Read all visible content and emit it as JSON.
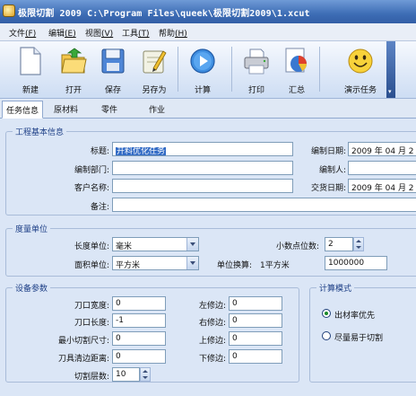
{
  "window": {
    "title": "极限切割  2009 C:\\Program Files\\queek\\极限切割2009\\1.xcut"
  },
  "menu": [
    {
      "label": "文件",
      "key": "(F)"
    },
    {
      "label": "编辑",
      "key": "(E)"
    },
    {
      "label": "视图",
      "key": "(V)"
    },
    {
      "label": "工具",
      "key": "(T)"
    },
    {
      "label": "帮助",
      "key": "(H)"
    }
  ],
  "toolbar": {
    "new": "新建",
    "open": "打开",
    "save": "保存",
    "save_as": "另存为",
    "calc": "计算",
    "print": "打印",
    "summary": "汇总",
    "demo": "演示任务"
  },
  "tabs": [
    "任务信息",
    "原材料",
    "零件",
    "作业"
  ],
  "project_info": {
    "group_title": "工程基本信息",
    "title_label": "标题:",
    "title_value": "开料优化任务",
    "compile_date_label": "编制日期:",
    "compile_date_value": "2009 年 04 月 2",
    "dept_label": "编制部门:",
    "dept_value": "",
    "author_label": "编制人:",
    "author_value": "",
    "client_label": "客户名称:",
    "client_value": "",
    "delivery_label": "交货日期:",
    "delivery_value": "2009 年 04 月 2",
    "note_label": "备注:",
    "note_value": ""
  },
  "units": {
    "group_title": "度量单位",
    "length_label": "长度单位:",
    "length_value": "毫米",
    "decimals_label": "小数点位数:",
    "decimals_value": "2",
    "area_label": "面积单位:",
    "area_value": "平方米",
    "conversion_label": "单位换算:",
    "conversion_unit": "1平方米",
    "conversion_value": "1000000"
  },
  "equipment": {
    "group_title": "设备参数",
    "blade_width_label": "刀口宽度:",
    "blade_width_value": "0",
    "blade_length_label": "刀口长度:",
    "blade_length_value": "-1",
    "min_cut_label": "最小切割尺寸:",
    "min_cut_value": "0",
    "tool_clear_label": "刀具清边距离:",
    "tool_clear_value": "0",
    "layers_label": "切割层数:",
    "layers_value": "10",
    "left_trim_label": "左修边:",
    "left_trim_value": "0",
    "right_trim_label": "右修边:",
    "right_trim_value": "0",
    "top_trim_label": "上修边:",
    "top_trim_value": "0",
    "bottom_trim_label": "下修边:",
    "bottom_trim_value": "0"
  },
  "calc_mode": {
    "group_title": "计算模式",
    "option1": "出材率优先",
    "option2": "尽量易于切割",
    "selected": "出材率优先"
  },
  "colors": {
    "titlebar": "#3d6db5",
    "background": "#dbe6f6",
    "group_title": "#1d3f86",
    "selection": "#316ac5"
  }
}
